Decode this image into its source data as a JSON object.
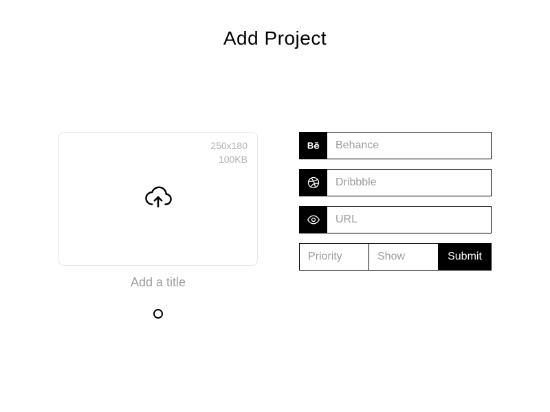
{
  "page": {
    "title": "Add Project"
  },
  "upload": {
    "dimensions_hint": "250x180",
    "size_hint": "100KB",
    "title_placeholder": "Add a title"
  },
  "fields": {
    "behance": {
      "placeholder": "Behance"
    },
    "dribbble": {
      "placeholder": "Dribbble"
    },
    "url": {
      "placeholder": "URL"
    }
  },
  "bottom": {
    "priority_placeholder": "Priority",
    "show_placeholder": "Show",
    "submit_label": "Submit"
  }
}
